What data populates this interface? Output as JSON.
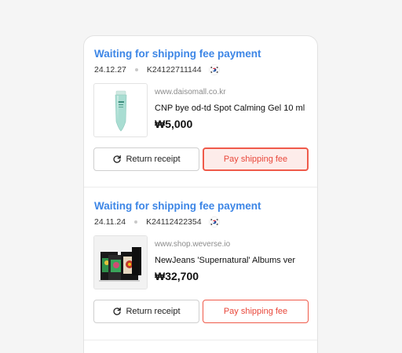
{
  "orders": [
    {
      "status": "Waiting for shipping fee payment",
      "date": "24.12.27",
      "order_no": "K24122711144",
      "site": "www.daisomall.co.kr",
      "product": "CNP bye od-td Spot Calming Gel 10 ml",
      "price": "₩5,000",
      "receipt_label": "Return receipt",
      "pay_label": "Pay shipping fee",
      "pay_state": "pressed"
    },
    {
      "status": "Waiting for shipping fee payment",
      "date": "24.11.24",
      "order_no": "K24112422354",
      "site": "www.shop.weverse.io",
      "product": "NewJeans 'Supernatural' Albums ver",
      "price": "₩32,700",
      "receipt_label": "Return receipt",
      "pay_label": "Pay shipping fee",
      "pay_state": "default"
    }
  ],
  "icons": {
    "receipt": "refresh-icon",
    "flag": "korea-flag-icon"
  },
  "colors": {
    "status": "#3d86e6",
    "accent": "#ef5a4a",
    "accent_pressed_bg": "#fdecea"
  }
}
